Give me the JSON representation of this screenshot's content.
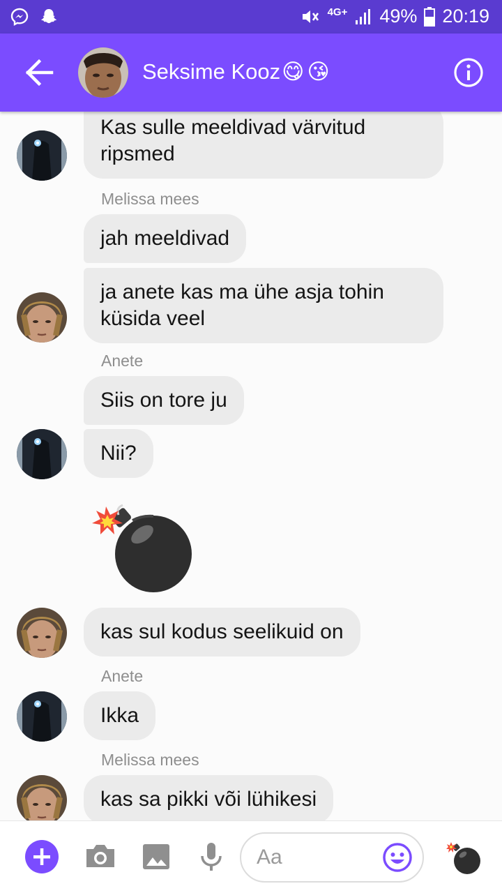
{
  "status_bar": {
    "icons": [
      "messenger-icon",
      "snapchat-icon",
      "mute-icon",
      "lte-icon",
      "signal-icon",
      "battery-icon"
    ],
    "network": "4G+",
    "battery": "49%",
    "time": "20:19"
  },
  "header": {
    "title": "Seksime Kooz",
    "title_emojis": [
      "😋",
      "😘"
    ],
    "back_icon": "back-arrow-icon",
    "info_icon": "info-icon"
  },
  "messages": [
    {
      "sender": "",
      "text_lines": [
        "Kas sulle meeldivad värvitud",
        "ripsmed"
      ],
      "avatar": "avatar-dark"
    },
    {
      "sender": "Melissa mees",
      "text_lines": [
        "jah meeldivad"
      ],
      "avatar": ""
    },
    {
      "sender": "",
      "text_lines": [
        "ja anete kas ma ühe asja tohin",
        "küsida veel"
      ],
      "avatar": "avatar-blond"
    },
    {
      "sender": "Anete",
      "text_lines": [
        "Siis on tore ju"
      ],
      "avatar": ""
    },
    {
      "sender": "",
      "text_lines": [
        "Nii?"
      ],
      "avatar": "avatar-dark"
    },
    {
      "sender": "",
      "sticker": "bomb-emoji",
      "avatar": ""
    },
    {
      "sender": "",
      "text_lines": [
        "kas sul kodus seelikuid on"
      ],
      "avatar": "avatar-blond"
    },
    {
      "sender": "Anete",
      "text_lines": [
        "Ikka"
      ],
      "avatar": "avatar-dark"
    },
    {
      "sender": "Melissa mees",
      "text_lines": [
        "kas sa pikki või lühikesi"
      ],
      "avatar": "avatar-blond"
    }
  ],
  "composer": {
    "placeholder": "Aa",
    "buttons": [
      "plus-icon",
      "camera-icon",
      "image-icon",
      "microphone-icon",
      "emoji-icon",
      "bomb-icon"
    ]
  },
  "colors": {
    "status_bar": "#5a3bd0",
    "header": "#7b4cff",
    "accent": "#7b4cff",
    "bubble": "#ebebeb"
  }
}
